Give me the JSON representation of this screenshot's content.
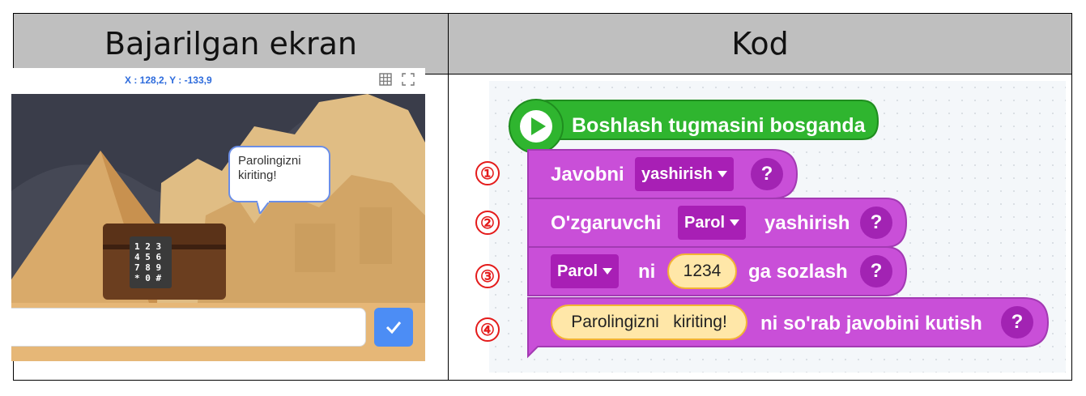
{
  "table": {
    "left_header": "Bajarilgan ekran",
    "right_header": "Kod"
  },
  "stage": {
    "coordinates": "X : 128,2, Y : -133,9",
    "speech_bubble": "Parolingizni kiriting!",
    "keypad_keys": [
      "1",
      "2",
      "3",
      "4",
      "5",
      "6",
      "7",
      "8",
      "9",
      "*",
      "0",
      "#"
    ],
    "tool_icons": [
      "grid-icon",
      "fullscreen-icon"
    ],
    "submit_icon": "checkmark-icon"
  },
  "code": {
    "start_block": "Boshlash tugmasini bosganda",
    "markers": [
      "①",
      "②",
      "③",
      "④"
    ],
    "line1": {
      "text": "Javobni",
      "dropdown": "yashirish",
      "help": "?"
    },
    "line2": {
      "text": "O'zgaruvchi",
      "dropdown": "Parol",
      "text2": "yashirish",
      "help": "?"
    },
    "line3": {
      "dropdown": "Parol",
      "text": "ni",
      "value": "1234",
      "text2": "ga sozlash",
      "help": "?"
    },
    "line4": {
      "value": "Parolingizni   kiriting!",
      "text": "ni so'rab javobini kutish",
      "help": "?"
    }
  },
  "colors": {
    "start_block": "#2fb52f",
    "block": "#c94fd8",
    "dropdown": "#a81fb5",
    "marker": "#e41b1b"
  }
}
